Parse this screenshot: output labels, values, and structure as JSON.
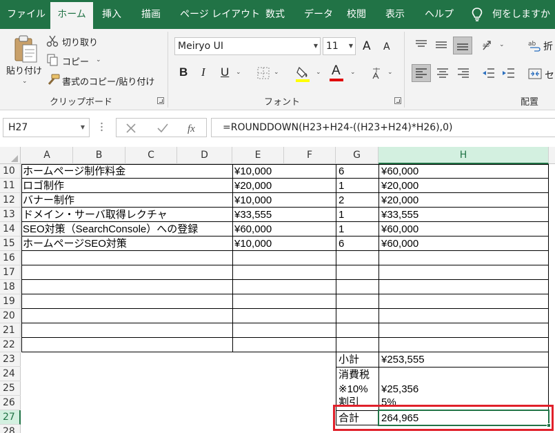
{
  "tabs": [
    "ファイル",
    "ホーム",
    "挿入",
    "描画",
    "ページ レイアウト",
    "数式",
    "データ",
    "校閲",
    "表示",
    "ヘルプ"
  ],
  "tell_me": "何をしますか",
  "clipboard": {
    "paste": "貼り付け",
    "cut": "切り取り",
    "copy": "コピー",
    "format_painter": "書式のコピー/貼り付け",
    "group_label": "クリップボード"
  },
  "font": {
    "name": "Meiryo UI",
    "size": "11",
    "group_label": "フォント",
    "bold": "B",
    "italic": "I",
    "underline": "U",
    "grow": "A",
    "shrink": "A",
    "font_color_letter": "A",
    "fill_color": "#ffff00",
    "font_color": "#e00000"
  },
  "alignment": {
    "group_label": "配置",
    "wrap_text": "折",
    "merge": "セ"
  },
  "formula_bar": {
    "name_box": "H27",
    "formula": "=ROUNDDOWN(H23+H24-((H23+H24)*H26),0)"
  },
  "columns": [
    "A",
    "B",
    "C",
    "D",
    "E",
    "F",
    "G",
    "H"
  ],
  "rows": [
    "10",
    "11",
    "12",
    "13",
    "14",
    "15",
    "16",
    "17",
    "18",
    "19",
    "20",
    "21",
    "22",
    "23",
    "24",
    "25",
    "26",
    "27",
    "28"
  ],
  "items": [
    {
      "name": "ホームページ制作料金",
      "price": "¥10,000",
      "qty": "6",
      "amount": "¥60,000"
    },
    {
      "name": "ロゴ制作",
      "price": "¥20,000",
      "qty": "1",
      "amount": "¥20,000"
    },
    {
      "name": "バナー制作",
      "price": "¥10,000",
      "qty": "2",
      "amount": "¥20,000"
    },
    {
      "name": "ドメイン・サーバ取得レクチャ",
      "price": "¥33,555",
      "qty": "1",
      "amount": "¥33,555"
    },
    {
      "name": "SEO対策（SearchConsole）への登録",
      "price": "¥60,000",
      "qty": "1",
      "amount": "¥60,000"
    },
    {
      "name": "ホームページSEO対策",
      "price": "¥10,000",
      "qty": "6",
      "amount": "¥60,000"
    }
  ],
  "summary": {
    "subtotal_label": "小計",
    "subtotal_value": "¥253,555",
    "tax_label_1": "消費税",
    "tax_label_2": "※10%",
    "tax_value": "¥25,356",
    "discount_label": "割引",
    "discount_value": "5%",
    "total_label": "合計",
    "total_value": "264,965"
  },
  "colors": {
    "excel_green": "#217346",
    "highlight_red": "#e0202a"
  }
}
